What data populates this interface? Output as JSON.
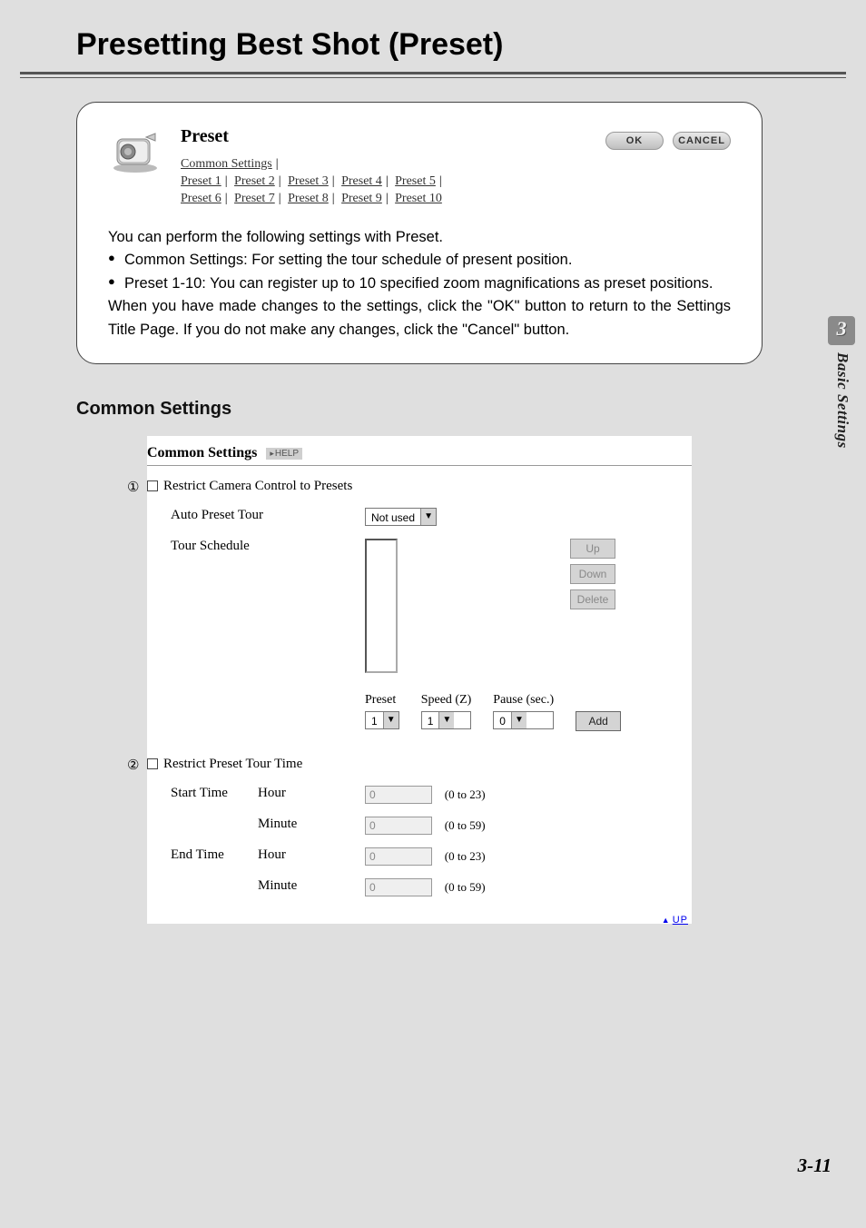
{
  "page": {
    "title": "Presetting Best Shot (Preset)",
    "number": "3-11"
  },
  "side_tab": {
    "chapter_num": "3",
    "chapter_title": "Basic Settings"
  },
  "panel": {
    "title": "Preset",
    "ok": "OK",
    "cancel": "CANCEL",
    "links": {
      "common": "Common Settings",
      "presets": [
        "Preset 1",
        "Preset 2",
        "Preset 3",
        "Preset 4",
        "Preset 5",
        "Preset 6",
        "Preset 7",
        "Preset 8",
        "Preset 9",
        "Preset 10"
      ]
    }
  },
  "description": {
    "intro": "You can perform the following settings with Preset.",
    "b1": "Common Settings: For setting the tour schedule of present position.",
    "b2": "Preset 1-10: You can register up to 10 specified zoom magnifications as preset positions.",
    "outro": "When you have made changes to the settings, click the \"OK\" button to return to the Settings Title Page. If you do not make any changes, click the \"Cancel\" button."
  },
  "section_heading": "Common Settings",
  "settings": {
    "header": "Common Settings",
    "help": "HELP",
    "n1": "①",
    "n2": "②",
    "restrict_control": "Restrict Camera Control to Presets",
    "auto_tour_lbl": "Auto Preset Tour",
    "auto_tour_val": "Not used",
    "tour_schedule_lbl": "Tour Schedule",
    "btn_up": "Up",
    "btn_down": "Down",
    "btn_delete": "Delete",
    "btn_add": "Add",
    "preset_lbl": "Preset",
    "speed_lbl": "Speed (Z)",
    "pause_lbl": "Pause (sec.)",
    "preset_val": "1",
    "speed_val": "1",
    "pause_val": "0",
    "restrict_time": "Restrict Preset Tour Time",
    "start_time": "Start Time",
    "end_time": "End Time",
    "hour": "Hour",
    "minute": "Minute",
    "hour_range": "(0 to 23)",
    "minute_range": "(0 to 59)",
    "default_zero": "0",
    "up_link": "UP"
  }
}
